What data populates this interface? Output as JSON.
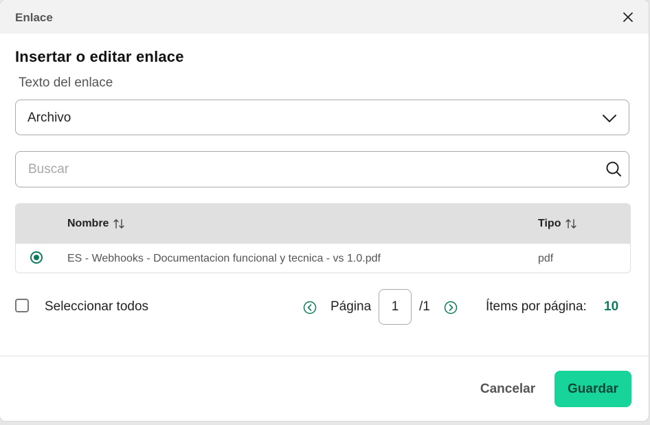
{
  "dialog": {
    "title": "Enlace",
    "heading": "Insertar o editar enlace",
    "link_text_label": "Texto del enlace"
  },
  "source_select": {
    "value": "Archivo"
  },
  "search": {
    "placeholder": "Buscar",
    "value": ""
  },
  "table": {
    "columns": [
      "Nombre",
      "Tipo"
    ],
    "rows": [
      {
        "selected": true,
        "name": "ES - Webhooks - Documentacion funcional y tecnica - vs 1.0.pdf",
        "type": "pdf"
      }
    ]
  },
  "footer_controls": {
    "select_all_label": "Seleccionar todos",
    "page_label": "Página",
    "current_page": "1",
    "total_pages": "/1",
    "items_per_page_label": "Ítems por página:",
    "items_per_page_value": "10"
  },
  "actions": {
    "cancel_label": "Cancelar",
    "save_label": "Guardar"
  },
  "colors": {
    "accent": "#0d7a5f",
    "primary_button": "#16d49a",
    "header_bg": "#f2f2f2",
    "table_header_bg": "#e0e0e0"
  }
}
